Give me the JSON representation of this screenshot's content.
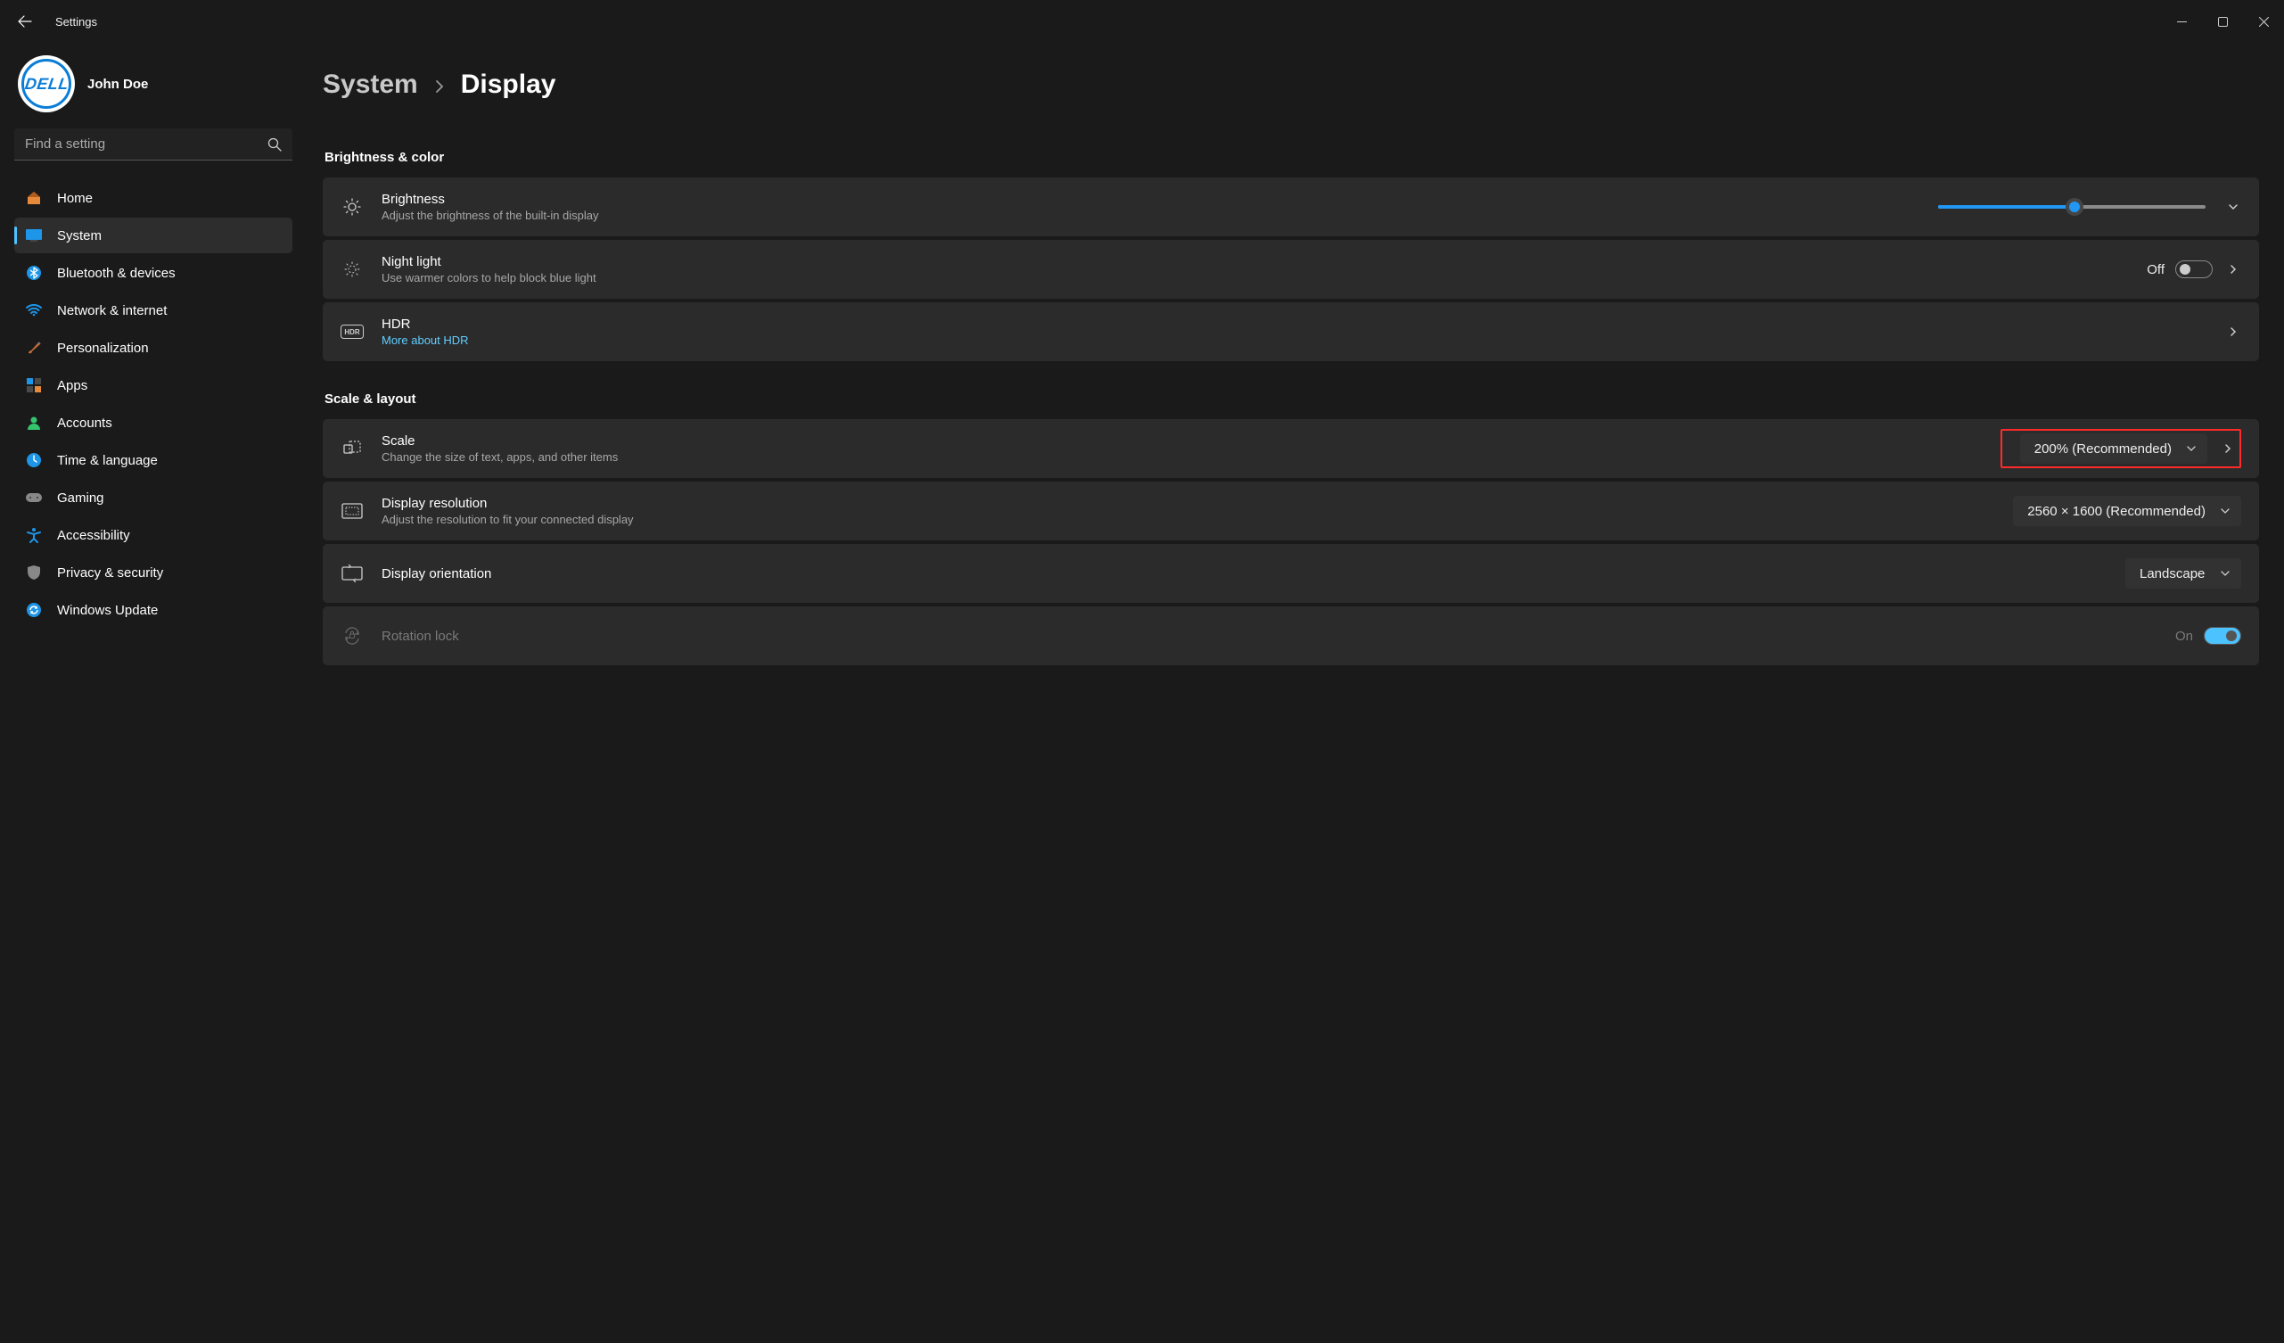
{
  "titlebar": {
    "title": "Settings"
  },
  "profile": {
    "avatar_text": "DELL",
    "name": "John Doe"
  },
  "search": {
    "placeholder": "Find a setting"
  },
  "nav": {
    "items": [
      {
        "label": "Home"
      },
      {
        "label": "System"
      },
      {
        "label": "Bluetooth & devices"
      },
      {
        "label": "Network & internet"
      },
      {
        "label": "Personalization"
      },
      {
        "label": "Apps"
      },
      {
        "label": "Accounts"
      },
      {
        "label": "Time & language"
      },
      {
        "label": "Gaming"
      },
      {
        "label": "Accessibility"
      },
      {
        "label": "Privacy & security"
      },
      {
        "label": "Windows Update"
      }
    ]
  },
  "breadcrumb": {
    "parent": "System",
    "current": "Display"
  },
  "sections": {
    "brightness_color": {
      "title": "Brightness & color"
    },
    "scale_layout": {
      "title": "Scale & layout"
    }
  },
  "cards": {
    "brightness": {
      "title": "Brightness",
      "sub": "Adjust the brightness of the built-in display",
      "slider_percent": 51
    },
    "night_light": {
      "title": "Night light",
      "sub": "Use warmer colors to help block blue light",
      "toggle_label": "Off"
    },
    "hdr": {
      "title": "HDR",
      "link": "More about HDR"
    },
    "scale": {
      "title": "Scale",
      "sub": "Change the size of text, apps, and other items",
      "value": "200% (Recommended)"
    },
    "resolution": {
      "title": "Display resolution",
      "sub": "Adjust the resolution to fit your connected display",
      "value": "2560 × 1600 (Recommended)"
    },
    "orientation": {
      "title": "Display orientation",
      "value": "Landscape"
    },
    "rotation_lock": {
      "title": "Rotation lock",
      "toggle_label": "On"
    }
  }
}
